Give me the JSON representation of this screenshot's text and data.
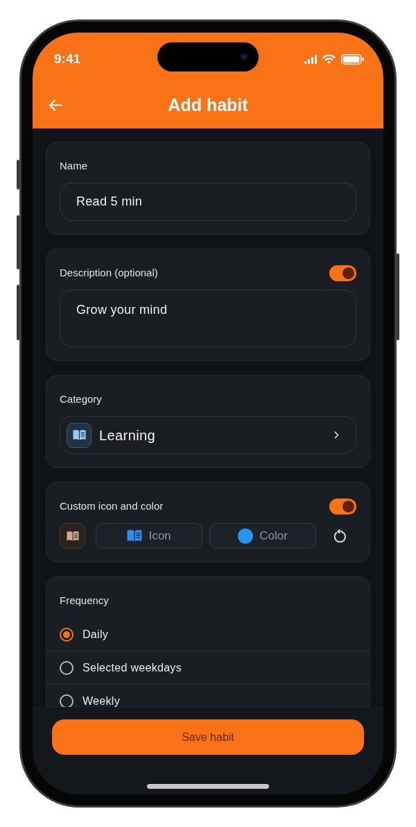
{
  "status_bar": {
    "time": "9:41"
  },
  "app_bar": {
    "title": "Add habit"
  },
  "name_field": {
    "label": "Name",
    "value": "Read 5 min"
  },
  "description": {
    "label": "Description (optional)",
    "enabled": true,
    "value": "Grow your mind"
  },
  "category": {
    "label": "Category",
    "value": "Learning"
  },
  "custom_icon": {
    "label": "Custom icon and color",
    "enabled": true,
    "icon_button": "Icon",
    "color_button": "Color"
  },
  "frequency": {
    "label": "Frequency",
    "options": [
      {
        "label": "Daily",
        "selected": true
      },
      {
        "label": "Selected weekdays",
        "selected": false
      },
      {
        "label": "Weekly",
        "selected": false
      }
    ]
  },
  "save_button": "Save habit"
}
